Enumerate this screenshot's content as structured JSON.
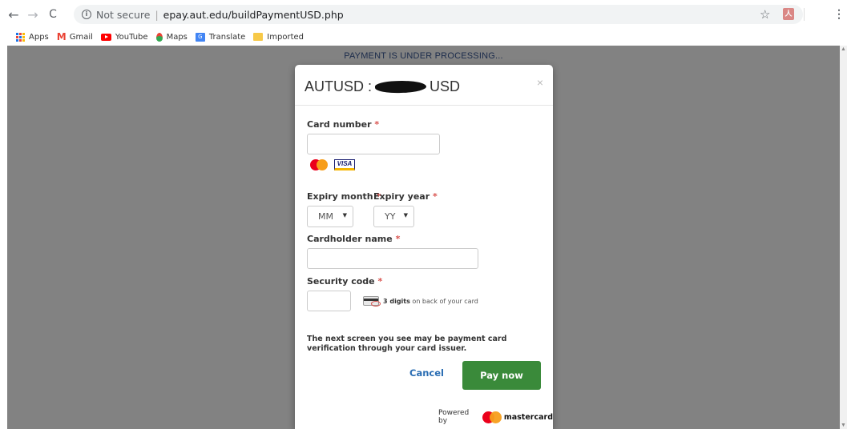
{
  "browser": {
    "security_label": "Not secure",
    "url": "epay.aut.edu/buildPaymentUSD.php",
    "icons": [
      "back-arrow-icon",
      "forward-arrow-icon",
      "reload-icon",
      "info-icon",
      "star-icon",
      "acrobat-extension-icon",
      "menu-kebab-icon"
    ]
  },
  "bookmarks": [
    {
      "label": "Apps",
      "icon": "apps-grid-icon"
    },
    {
      "label": "Gmail",
      "icon": "gmail-icon"
    },
    {
      "label": "YouTube",
      "icon": "youtube-icon"
    },
    {
      "label": "Maps",
      "icon": "maps-pin-icon"
    },
    {
      "label": "Translate",
      "icon": "translate-icon"
    },
    {
      "label": "Imported",
      "icon": "folder-icon"
    }
  ],
  "page": {
    "status_text": "PAYMENT IS UNDER PROCESSING..."
  },
  "modal": {
    "title_prefix": "AUTUSD :",
    "title_suffix": "USD",
    "close_glyph": "×",
    "card_number": {
      "label": "Card number",
      "required": "*",
      "value": ""
    },
    "expiry_month": {
      "label": "Expiry month",
      "required": "*",
      "selected": "MM"
    },
    "expiry_year": {
      "label": "Expiry year",
      "required": "*",
      "selected": "YY"
    },
    "cardholder": {
      "label": "Cardholder name",
      "required": "*",
      "value": ""
    },
    "security_code": {
      "label": "Security code",
      "required": "*",
      "value": "",
      "hint_bold": "3 digits",
      "hint_rest": "on back of your card"
    },
    "notice": "The next screen you see may be payment card verification through your card issuer.",
    "cancel_label": "Cancel",
    "pay_label": "Pay now",
    "powered_by": "Powered by",
    "brand_word": "mastercard",
    "card_brands": [
      "mastercard-logo",
      "visa-logo"
    ],
    "colors": {
      "pay_button": "#3a8a3a",
      "cancel_link": "#2a6db3",
      "required_star": "#d9534f",
      "overlay": "#828282"
    }
  }
}
